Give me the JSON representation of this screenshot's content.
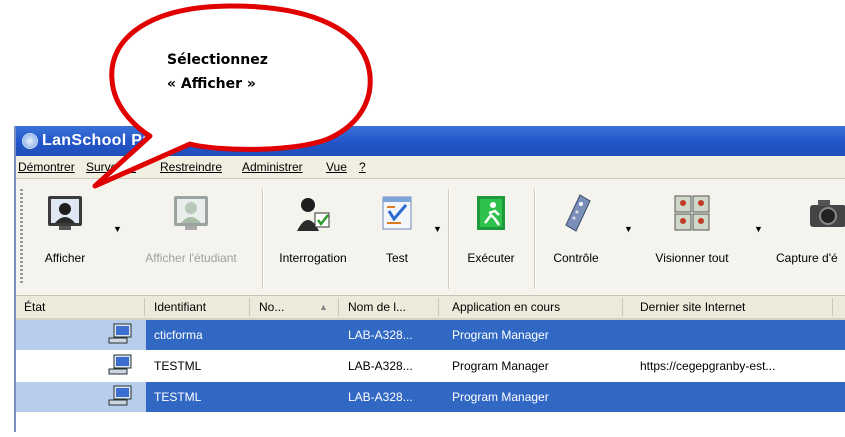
{
  "callout": {
    "line1": "Sélectionnez",
    "line2": "« Afficher »"
  },
  "window": {
    "title": "LanSchool Professeur"
  },
  "menu": {
    "demonstrate": "Démontrer",
    "watch": "Surveiller",
    "restrict": "Restreindre",
    "administer": "Administrer",
    "view": "Vue",
    "help": "?"
  },
  "toolbar": {
    "show": "Afficher",
    "show_student": "Afficher l'étudiant",
    "poll": "Interrogation",
    "test": "Test",
    "run": "Exécuter",
    "control": "Contrôle",
    "view_all": "Visionner tout",
    "capture": "Capture d'é"
  },
  "grid": {
    "headers": [
      "État",
      "Identifiant",
      "No...",
      "Nom de l...",
      "Application en cours",
      "Dernier site Internet"
    ],
    "rows": [
      {
        "identifiant": "cticforma",
        "no": "",
        "nom": "LAB-A328...",
        "app": "Program Manager",
        "site": "",
        "selected": true
      },
      {
        "identifiant": "TESTML",
        "no": "",
        "nom": "LAB-A328...",
        "app": "Program Manager",
        "site": "https://cegepgranby-est...",
        "selected": false
      },
      {
        "identifiant": "TESTML",
        "no": "",
        "nom": "LAB-A328...",
        "app": "Program Manager",
        "site": "",
        "selected": true
      }
    ]
  },
  "colors": {
    "accent": "#3168c4",
    "callout_border": "#e00000",
    "titlebar": "#2255c8"
  }
}
